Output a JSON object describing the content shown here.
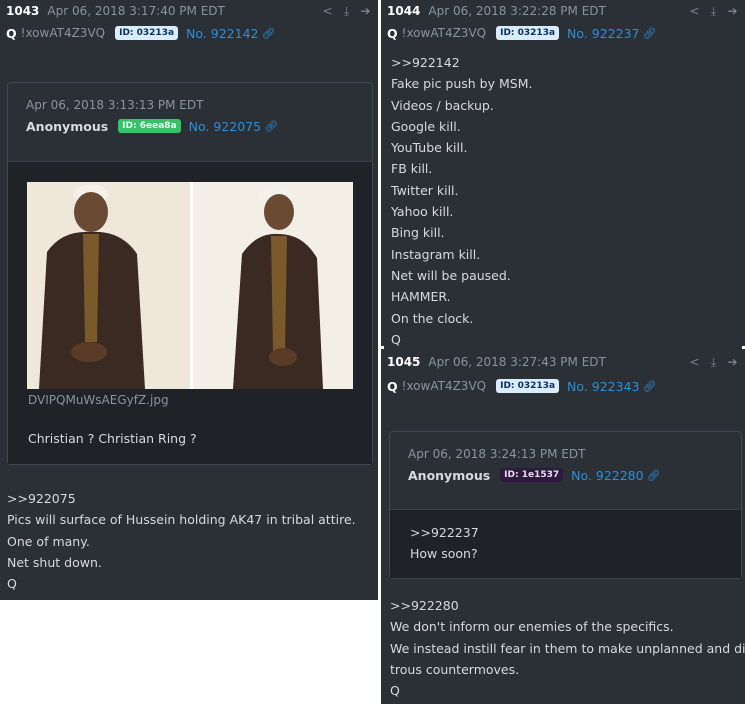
{
  "post_1043": {
    "num": "1043",
    "date": "Apr 06, 2018 3:17:40 PM EDT",
    "name": "Q",
    "trip": "!xowAT4Z3VQ",
    "id": "ID: 03213a",
    "post_no": "No. 922142",
    "quoted": {
      "date": "Apr 06, 2018 3:13:13 PM EDT",
      "name": "Anonymous",
      "id": "ID: 6eea8a",
      "post_no": "No. 922075",
      "filename": "DVIPQMuWsAEGyfZ.jpg",
      "text": "Christian ? Christian Ring ?"
    },
    "lines": [
      ">>922075",
      "Pics will surface of Hussein holding AK47 in tribal attire.",
      "One of many.",
      "Net shut down.",
      "Q"
    ]
  },
  "post_1044": {
    "num": "1044",
    "date": "Apr 06, 2018 3:22:28 PM EDT",
    "name": "Q",
    "trip": "!xowAT4Z3VQ",
    "id": "ID: 03213a",
    "post_no": "No. 922237",
    "lines": [
      ">>922142",
      "Fake pic push by MSM.",
      "Videos / backup.",
      "Google kill.",
      "YouTube kill.",
      "FB kill.",
      "Twitter kill.",
      "Yahoo kill.",
      "Bing kill.",
      "Instagram kill.",
      "Net will be paused.",
      "HAMMER.",
      "On the clock.",
      "Q"
    ]
  },
  "post_1045": {
    "num": "1045",
    "date": "Apr 06, 2018 3:27:43 PM EDT",
    "name": "Q",
    "trip": "!xowAT4Z3VQ",
    "id": "ID: 03213a",
    "post_no": "No. 922343",
    "quoted": {
      "date": "Apr 06, 2018 3:24:13 PM EDT",
      "name": "Anonymous",
      "id": "ID: 1e1537",
      "post_no": "No. 922280",
      "lines": [
        ">>922237",
        "How soon?"
      ]
    },
    "lines": [
      ">>922280",
      "We don't inform our enemies of the specifics.",
      "We instead instill fear in them to make unplanned and disas-",
      "trous countermoves.",
      "Q"
    ]
  },
  "icons": {
    "share": "share-icon",
    "download": "download-icon",
    "goto": "arrow-right-circle-icon",
    "link": "link-icon"
  },
  "colors": {
    "background": "#2b3036",
    "link": "#2d8fd6",
    "id_badge_q": "#d8ecfb",
    "id_badge_anon1": "#37c26a",
    "id_badge_anon2": "#2e1a3c"
  }
}
